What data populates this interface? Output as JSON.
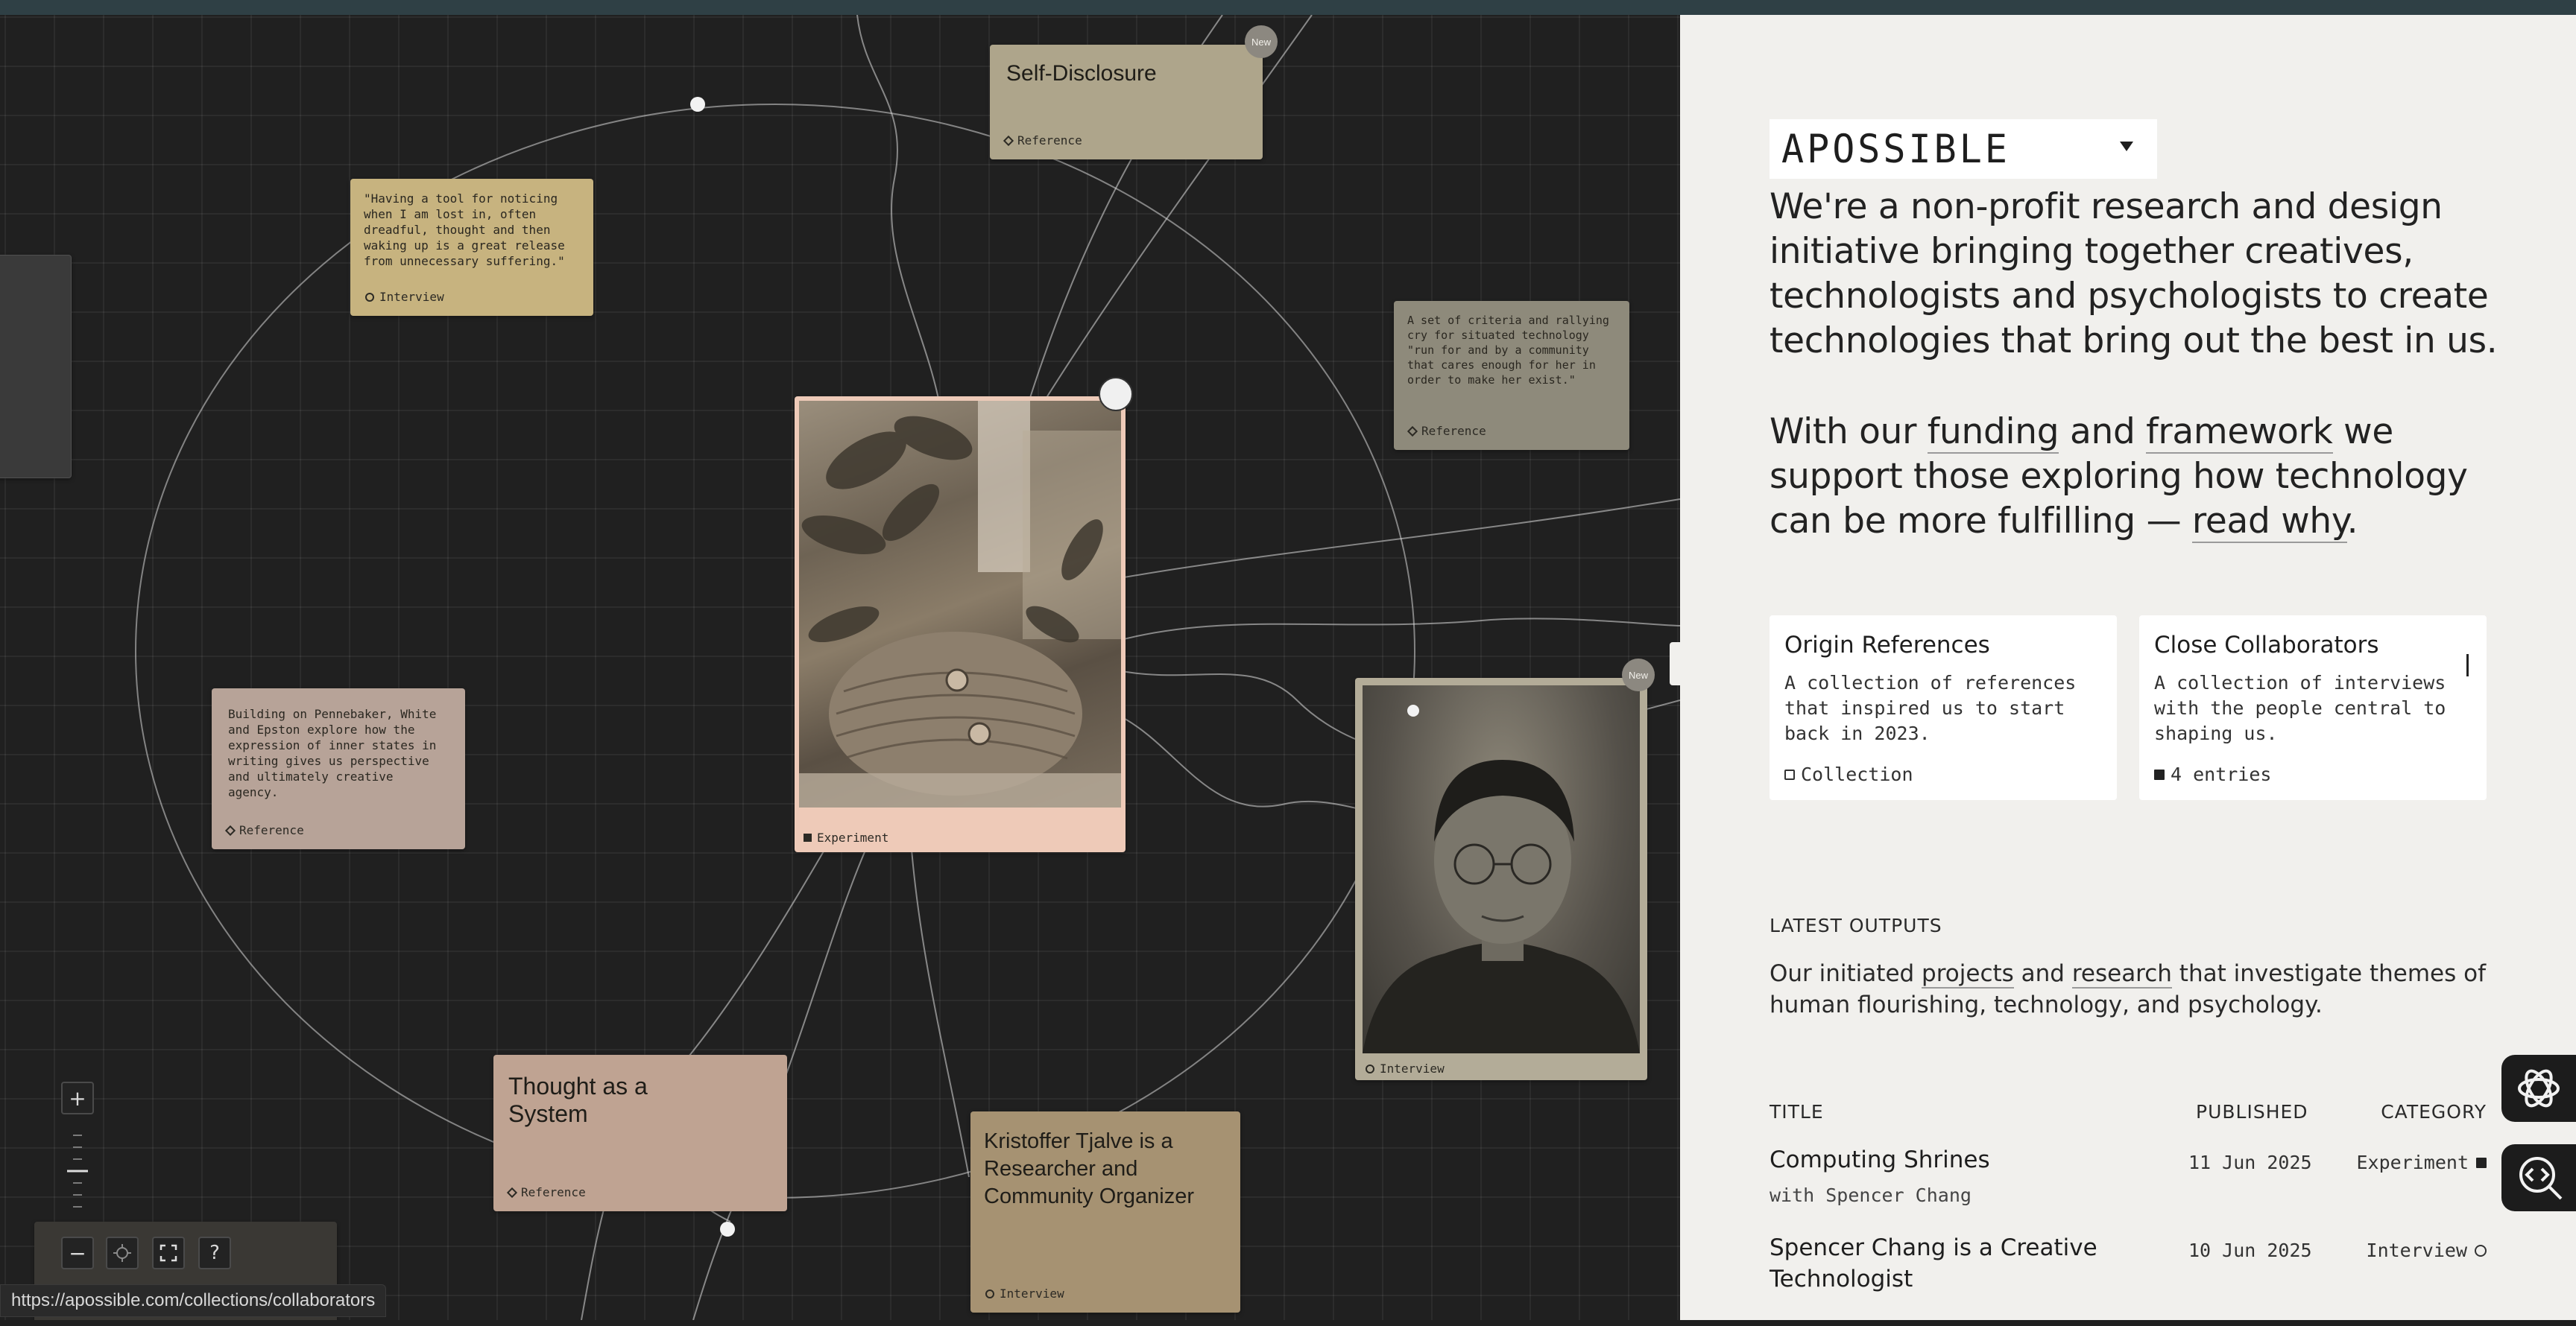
{
  "browser": {
    "status_url": "https://apossible.com/collections/collaborators"
  },
  "canvas": {
    "cards": {
      "self_disclosure": {
        "title": "Self-Disclosure",
        "tag": "Reference",
        "badge": "New"
      },
      "quote_interview": {
        "text": "\"Having a tool for noticing when I am lost in, often dreadful, thought and then waking up is a great release from unnecessary suffering.\"",
        "tag": "Interview"
      },
      "criteria": {
        "text": "A set of criteria and rallying cry for situated technology \"run for and by a community that cares enough for her in order to make her exist.\"",
        "tag": "Reference"
      },
      "pennebaker": {
        "text": "Building on Pennebaker, White and Epston explore how the expression of inner states in writing gives us perspective and ultimately creative agency.",
        "tag": "Reference"
      },
      "experiment_photo": {
        "tag": "Experiment"
      },
      "interview_photo": {
        "tag": "Interview",
        "badge": "New"
      },
      "thought_system": {
        "title": "Thought as a System",
        "tag": "Reference"
      },
      "kristoffer": {
        "title": "Kristoffer Tjalve is a Researcher and Community Organizer",
        "tag": "Interview"
      }
    },
    "controls": {
      "zoom_in": "+",
      "zoom_out": "−",
      "help": "?"
    }
  },
  "panel": {
    "logo": "APOSSIBLE",
    "intro": {
      "paragraph1": "We're a non-profit research and design initiative bringing together creatives, technologists and psychologists to create technologies that bring out the best in us.",
      "p2_a": "With our ",
      "p2_link1": "funding",
      "p2_b": " and ",
      "p2_link2": "framework",
      "p2_c": " we support those exploring how technology can be more fulfilling — ",
      "p2_link3": "read why",
      "p2_d": "."
    },
    "collections": [
      {
        "title": "Origin References",
        "description": "A collection of references that inspired us to start back in 2023.",
        "meta": "Collection"
      },
      {
        "title": "Close Collaborators",
        "description": "A collection of interviews with the people central to shaping us.",
        "meta": "4 entries"
      }
    ],
    "latest": {
      "label": "LATEST OUTPUTS",
      "desc_a": "Our initiated ",
      "desc_link1": "projects",
      "desc_b": " and ",
      "desc_link2": "research",
      "desc_c": " that investigate themes of human flourishing, technology, and psychology."
    },
    "table": {
      "headers": {
        "title": "TITLE",
        "published": "PUBLISHED",
        "category": "CATEGORY"
      },
      "rows": [
        {
          "title": "Computing Shrines",
          "subtitle": "with Spencer Chang",
          "published": "11 Jun 2025",
          "category": "Experiment"
        },
        {
          "title": "Spencer Chang is a Creative Technologist",
          "subtitle": "",
          "published": "10 Jun 2025",
          "category": "Interview"
        }
      ]
    }
  },
  "icons": {
    "side_button_1": "openai-logo-icon",
    "side_button_2": "search-code-icon"
  }
}
